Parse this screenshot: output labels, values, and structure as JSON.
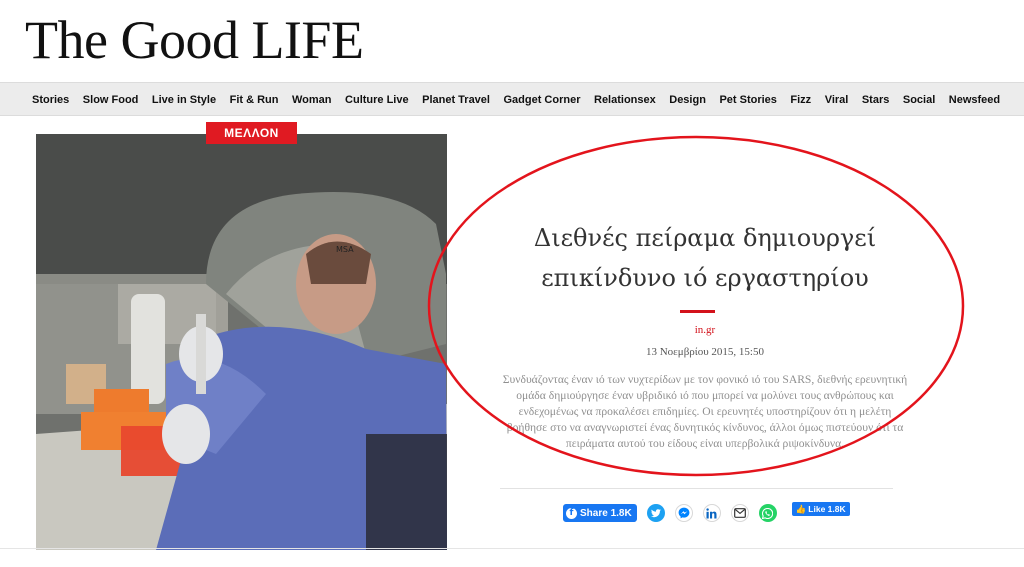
{
  "site": {
    "title": "The Good LIFE"
  },
  "nav": {
    "items": [
      "Stories",
      "Slow Food",
      "Live in Style",
      "Fit & Run",
      "Woman",
      "Culture Live",
      "Planet Travel",
      "Gadget Corner",
      "Relationsex",
      "Design",
      "Pet Stories",
      "Fizz",
      "Viral",
      "Stars",
      "Social",
      "Newsfeed"
    ]
  },
  "article": {
    "category": "ΜΕΛΛΟΝ",
    "headline_line1": "Διεθνές πείραμα δημιουργεί",
    "headline_line2": "επικίνδυνο ιό εργαστηρίου",
    "source": "in.gr",
    "date": "13 Νοεμβρίου 2015, 15:50",
    "summary": "Συνδυάζοντας έναν ιό των νυχτερίδων με τον φονικό ιό του SARS, διεθνής ερευνητική ομάδα δημιούργησε έναν υβριδικό ιό που μπορεί να μολύνει τους ανθρώπους και ενδεχομένως να προκαλέσει επιδημίες. Οι ερευνητές υποστηρίζουν ότι η μελέτη βοήθησε στο να αναγνωριστεί ένας δυνητικός κίνδυνος, άλλοι όμως πιστεύουν ότι τα πειράματα αυτού του είδους είναι υπερβολικά ριψοκίνδυνα."
  },
  "photo": {
    "helmet_label": "MSA"
  },
  "share": {
    "facebook_label": "Share 1.8K",
    "like_label": "Like 1.8K",
    "icons": [
      "twitter-icon",
      "messenger-icon",
      "linkedin-icon",
      "email-icon",
      "whatsapp-icon"
    ]
  },
  "colors": {
    "accent_red": "#d3121b",
    "facebook_blue": "#1877f2",
    "nav_bg": "#ececec"
  }
}
